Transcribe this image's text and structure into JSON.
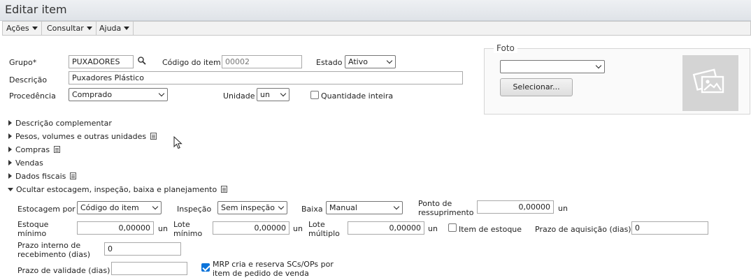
{
  "window": {
    "title": "Editar item"
  },
  "menu": [
    {
      "label": "Ações"
    },
    {
      "label": "Consultar"
    },
    {
      "label": "Ajuda"
    }
  ],
  "form": {
    "grupo": {
      "label": "Grupo*",
      "value": "PUXADORES"
    },
    "codigo": {
      "label": "Código do item",
      "value": "00002"
    },
    "estado": {
      "label": "Estado",
      "value": "Ativo"
    },
    "descricao": {
      "label": "Descrição",
      "value": "Puxadores Plástico"
    },
    "procedencia": {
      "label": "Procedência",
      "value": "Comprado"
    },
    "unidade": {
      "label": "Unidade",
      "value": "un"
    },
    "quantidade_inteira": {
      "label": "Quantidade inteira",
      "checked": false
    }
  },
  "foto": {
    "legend": "Foto",
    "select_value": "",
    "button_label": "Selecionar..."
  },
  "sections": [
    {
      "label": "Descrição complementar",
      "expanded": false,
      "has_doc_icon": false
    },
    {
      "label": "Pesos, volumes e outras unidades",
      "expanded": false,
      "has_doc_icon": true
    },
    {
      "label": "Compras",
      "expanded": false,
      "has_doc_icon": true
    },
    {
      "label": "Vendas",
      "expanded": false,
      "has_doc_icon": false
    },
    {
      "label": "Dados fiscais",
      "expanded": false,
      "has_doc_icon": true
    },
    {
      "label": "Ocultar estocagem, inspeção, baixa e planejamento",
      "expanded": true,
      "has_doc_icon": true
    }
  ],
  "estocagem": {
    "estocagem_por": {
      "label": "Estocagem por",
      "value": "Código do item"
    },
    "inspecao": {
      "label": "Inspeção",
      "value": "Sem inspeção"
    },
    "baixa": {
      "label": "Baixa",
      "value": "Manual"
    },
    "ponto_ressuprimento": {
      "label_line1": "Ponto de",
      "label_line2": "ressuprimento",
      "value": "0,00000",
      "unit": "un"
    },
    "estoque_minimo": {
      "label_line1": "Estoque",
      "label_line2": "mínimo",
      "value": "0,00000",
      "unit": "un"
    },
    "lote_minimo": {
      "label_line1": "Lote",
      "label_line2": "mínimo",
      "value": "0,00000",
      "unit": "un"
    },
    "lote_multiplo": {
      "label_line1": "Lote",
      "label_line2": "múltiplo",
      "value": "0,00000",
      "unit": "un"
    },
    "item_estoque": {
      "label": "Item de estoque",
      "checked": false
    },
    "prazo_aquisicao": {
      "label": "Prazo de aquisição (dias)",
      "value": "0"
    },
    "prazo_interno": {
      "label_line1": "Prazo interno de",
      "label_line2": "recebimento (dias)",
      "value": "0"
    },
    "prazo_validade": {
      "label": "Prazo de validade (dias)",
      "value": ""
    },
    "mrp": {
      "label_line1": "MRP cria e reserva SCs/OPs por",
      "label_line2": "item de pedido de venda",
      "checked": true
    }
  },
  "colors": {
    "accent": "#0b74da",
    "titlebar": "#e6e9ed",
    "menubar": "#f2f2f2",
    "photo_bg": "#d4d4d4"
  }
}
